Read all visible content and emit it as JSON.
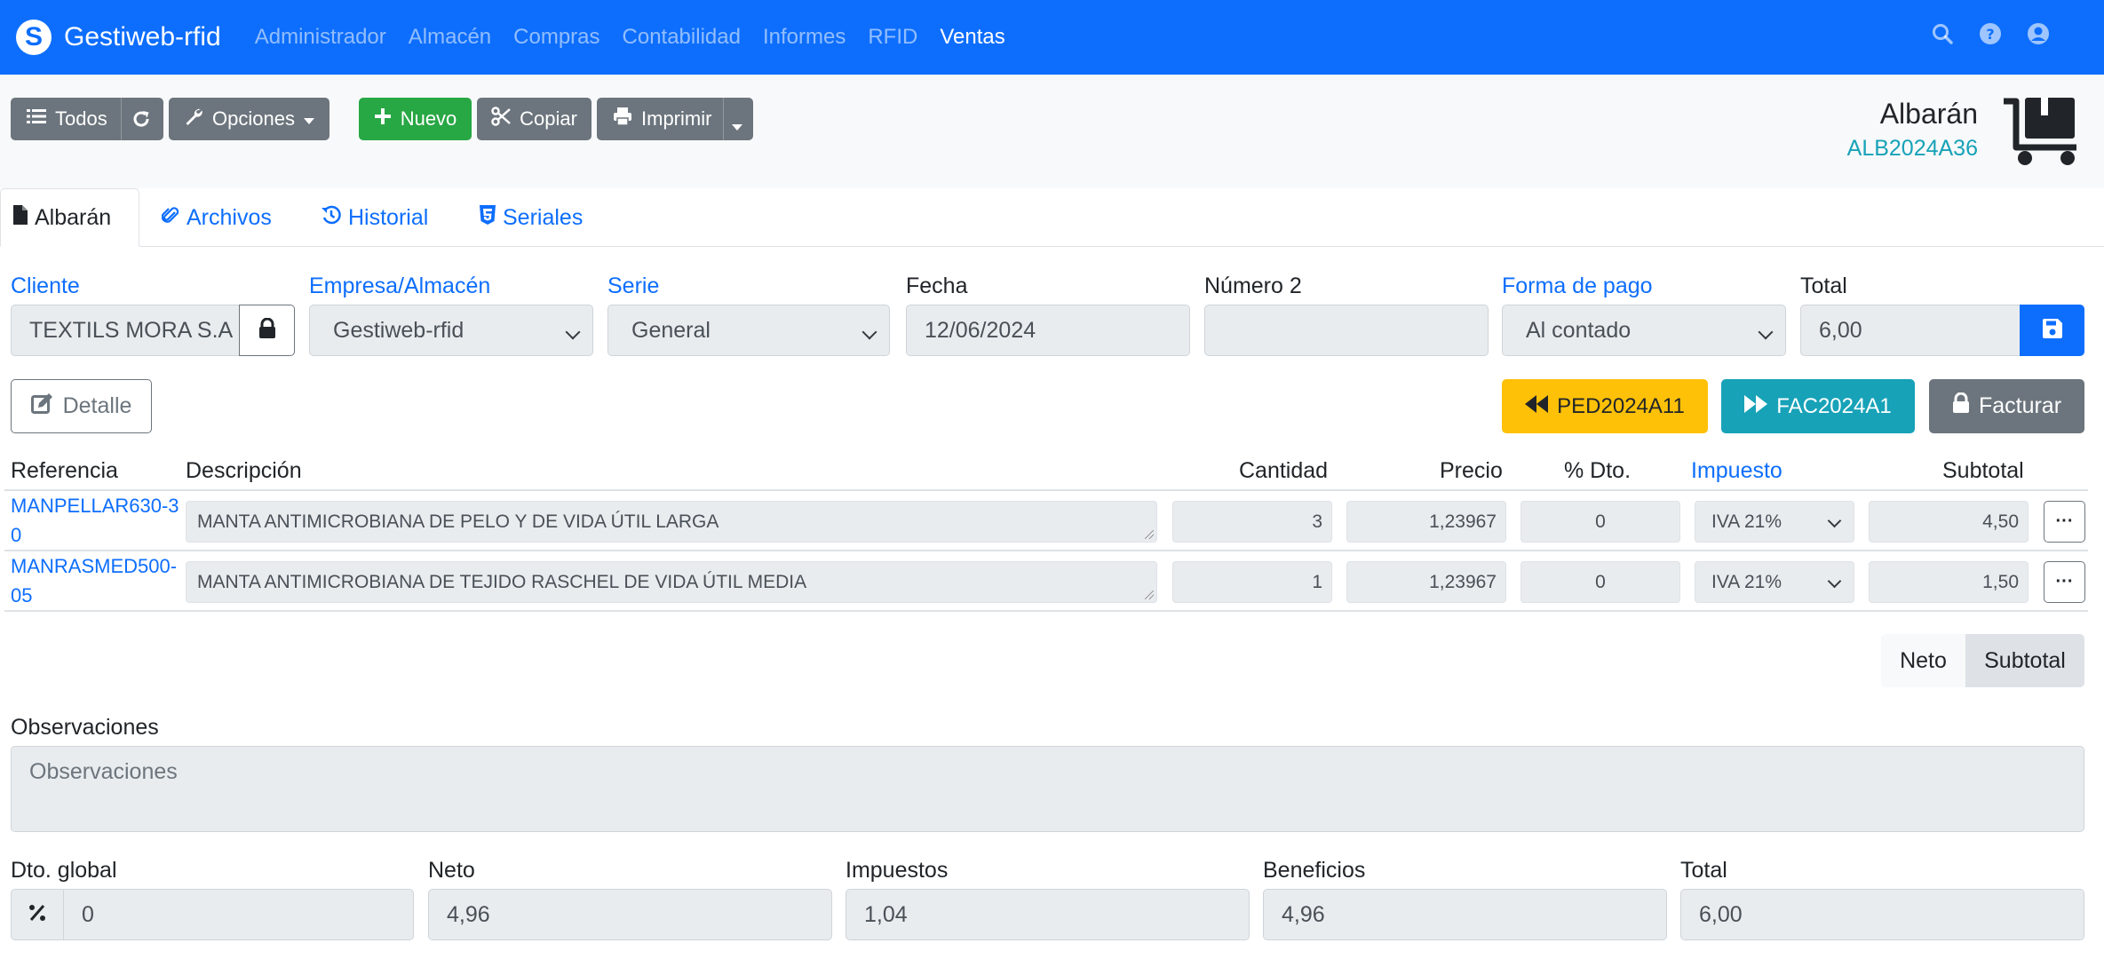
{
  "navbar": {
    "brand": "Gestiweb-rfid",
    "links": [
      "Administrador",
      "Almacén",
      "Compras",
      "Contabilidad",
      "Informes",
      "RFID",
      "Ventas"
    ],
    "active_link": "Ventas",
    "icons": [
      "search-icon",
      "help-icon",
      "user-icon"
    ]
  },
  "toolbar": {
    "todos_label": "Todos",
    "opciones_label": "Opciones",
    "nuevo_label": "Nuevo",
    "copiar_label": "Copiar",
    "imprimir_label": "Imprimir"
  },
  "document": {
    "title": "Albarán",
    "code": "ALB2024A36"
  },
  "tabs": [
    {
      "label": "Albarán",
      "active": true,
      "icon": "file-icon"
    },
    {
      "label": "Archivos",
      "active": false,
      "icon": "paperclip-icon"
    },
    {
      "label": "Historial",
      "active": false,
      "icon": "history-icon"
    },
    {
      "label": "Seriales",
      "active": false,
      "icon": "html5-icon"
    }
  ],
  "form": {
    "cliente_label": "Cliente",
    "cliente_value": "TEXTILS MORA S.A",
    "empresa_label": "Empresa/Almacén",
    "empresa_value": "Gestiweb-rfid",
    "serie_label": "Serie",
    "serie_value": "General",
    "fecha_label": "Fecha",
    "fecha_value": "12/06/2024",
    "numero2_label": "Número 2",
    "numero2_value": "",
    "forma_pago_label": "Forma de pago",
    "forma_pago_value": "Al contado",
    "total_label": "Total",
    "total_value": "6,00"
  },
  "actions": {
    "detalle_label": "Detalle",
    "pedido_label": "PED2024A11",
    "factura_label": "FAC2024A1",
    "facturar_label": "Facturar"
  },
  "lines": {
    "headers": {
      "referencia": "Referencia",
      "descripcion": "Descripción",
      "cantidad": "Cantidad",
      "precio": "Precio",
      "dto": "% Dto.",
      "impuesto": "Impuesto",
      "subtotal": "Subtotal"
    },
    "rows": [
      {
        "referencia": "MANPELLAR630-30",
        "descripcion": "MANTA ANTIMICROBIANA DE PELO Y DE VIDA ÚTIL LARGA",
        "cantidad": "3",
        "precio": "1,23967",
        "dto": "0",
        "impuesto": "IVA 21%",
        "subtotal": "4,50"
      },
      {
        "referencia": "MANRASMED500-05",
        "descripcion": "MANTA ANTIMICROBIANA DE TEJIDO RASCHEL DE VIDA ÚTIL MEDIA",
        "cantidad": "1",
        "precio": "1,23967",
        "dto": "0",
        "impuesto": "IVA 21%",
        "subtotal": "1,50"
      }
    ]
  },
  "toggle": {
    "neto_label": "Neto",
    "subtotal_label": "Subtotal",
    "selected": "Subtotal"
  },
  "observaciones": {
    "label": "Observaciones",
    "placeholder": "Observaciones"
  },
  "totals": {
    "dto_global_label": "Dto. global",
    "dto_global_value": "0",
    "neto_label": "Neto",
    "neto_value": "4,96",
    "impuestos_label": "Impuestos",
    "impuestos_value": "1,04",
    "beneficios_label": "Beneficios",
    "beneficios_value": "4,96",
    "total_label": "Total",
    "total_value": "6,00"
  },
  "colors": {
    "primary": "#0d6efd",
    "success": "#28a745",
    "secondary": "#6c757d",
    "warning": "#ffc107",
    "info": "#17a2b8"
  }
}
